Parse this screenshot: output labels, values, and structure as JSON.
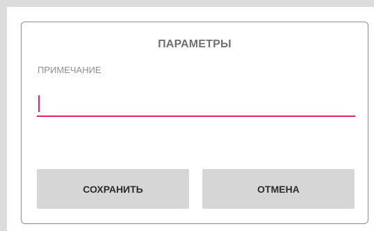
{
  "dialog": {
    "title": "ПАРАМЕТРЫ",
    "note_label": "ПРИМЕЧАНИЕ",
    "note_value": "",
    "note_placeholder": "",
    "save_label": "СОХРАНИТЬ",
    "cancel_label": "ОТМЕНА"
  },
  "colors": {
    "accent": "#e91e63",
    "button_bg": "#d6d6d6",
    "title_text": "#6f6f6f"
  }
}
